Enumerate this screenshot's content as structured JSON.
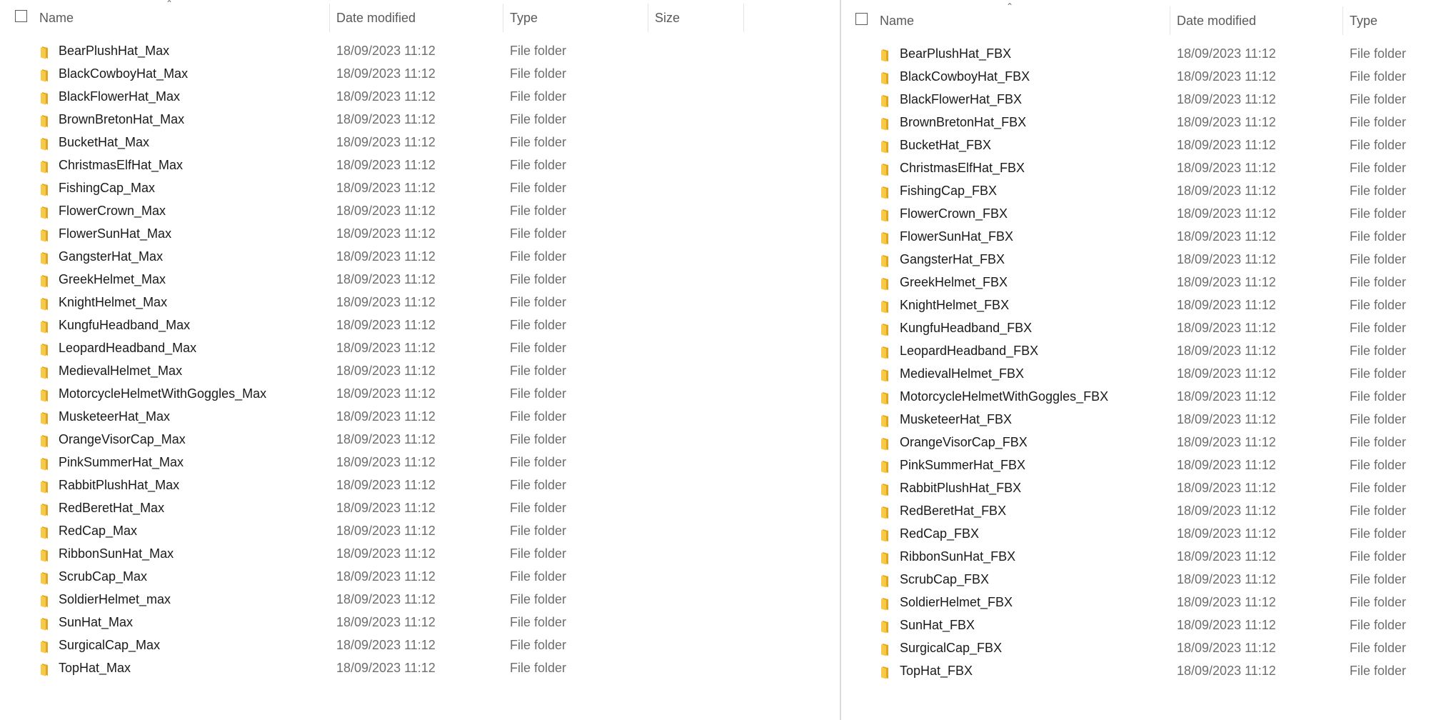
{
  "colors": {
    "folder": "#F8C84A",
    "folder_shade": "#E3A71F",
    "header_text": "#5a5a5a",
    "muted_text": "#6d6d6d"
  },
  "left_pane": {
    "columns": {
      "name": "Name",
      "date_modified": "Date modified",
      "type": "Type",
      "size": "Size"
    },
    "rows": [
      {
        "name": "BearPlushHat_Max",
        "date": "18/09/2023 11:12",
        "type": "File folder"
      },
      {
        "name": "BlackCowboyHat_Max",
        "date": "18/09/2023 11:12",
        "type": "File folder"
      },
      {
        "name": "BlackFlowerHat_Max",
        "date": "18/09/2023 11:12",
        "type": "File folder"
      },
      {
        "name": "BrownBretonHat_Max",
        "date": "18/09/2023 11:12",
        "type": "File folder"
      },
      {
        "name": "BucketHat_Max",
        "date": "18/09/2023 11:12",
        "type": "File folder"
      },
      {
        "name": "ChristmasElfHat_Max",
        "date": "18/09/2023 11:12",
        "type": "File folder"
      },
      {
        "name": "FishingCap_Max",
        "date": "18/09/2023 11:12",
        "type": "File folder"
      },
      {
        "name": "FlowerCrown_Max",
        "date": "18/09/2023 11:12",
        "type": "File folder"
      },
      {
        "name": "FlowerSunHat_Max",
        "date": "18/09/2023 11:12",
        "type": "File folder"
      },
      {
        "name": "GangsterHat_Max",
        "date": "18/09/2023 11:12",
        "type": "File folder"
      },
      {
        "name": "GreekHelmet_Max",
        "date": "18/09/2023 11:12",
        "type": "File folder"
      },
      {
        "name": "KnightHelmet_Max",
        "date": "18/09/2023 11:12",
        "type": "File folder"
      },
      {
        "name": "KungfuHeadband_Max",
        "date": "18/09/2023 11:12",
        "type": "File folder"
      },
      {
        "name": "LeopardHeadband_Max",
        "date": "18/09/2023 11:12",
        "type": "File folder"
      },
      {
        "name": "MedievalHelmet_Max",
        "date": "18/09/2023 11:12",
        "type": "File folder"
      },
      {
        "name": "MotorcycleHelmetWithGoggles_Max",
        "date": "18/09/2023 11:12",
        "type": "File folder"
      },
      {
        "name": "MusketeerHat_Max",
        "date": "18/09/2023 11:12",
        "type": "File folder"
      },
      {
        "name": "OrangeVisorCap_Max",
        "date": "18/09/2023 11:12",
        "type": "File folder"
      },
      {
        "name": "PinkSummerHat_Max",
        "date": "18/09/2023 11:12",
        "type": "File folder"
      },
      {
        "name": "RabbitPlushHat_Max",
        "date": "18/09/2023 11:12",
        "type": "File folder"
      },
      {
        "name": "RedBeretHat_Max",
        "date": "18/09/2023 11:12",
        "type": "File folder"
      },
      {
        "name": "RedCap_Max",
        "date": "18/09/2023 11:12",
        "type": "File folder"
      },
      {
        "name": "RibbonSunHat_Max",
        "date": "18/09/2023 11:12",
        "type": "File folder"
      },
      {
        "name": "ScrubCap_Max",
        "date": "18/09/2023 11:12",
        "type": "File folder"
      },
      {
        "name": "SoldierHelmet_max",
        "date": "18/09/2023 11:12",
        "type": "File folder"
      },
      {
        "name": "SunHat_Max",
        "date": "18/09/2023 11:12",
        "type": "File folder"
      },
      {
        "name": "SurgicalCap_Max",
        "date": "18/09/2023 11:12",
        "type": "File folder"
      },
      {
        "name": "TopHat_Max",
        "date": "18/09/2023 11:12",
        "type": "File folder"
      }
    ]
  },
  "right_pane": {
    "columns": {
      "name": "Name",
      "date_modified": "Date modified",
      "type": "Type"
    },
    "rows": [
      {
        "name": "BearPlushHat_FBX",
        "date": "18/09/2023 11:12",
        "type": "File folder"
      },
      {
        "name": "BlackCowboyHat_FBX",
        "date": "18/09/2023 11:12",
        "type": "File folder"
      },
      {
        "name": "BlackFlowerHat_FBX",
        "date": "18/09/2023 11:12",
        "type": "File folder"
      },
      {
        "name": "BrownBretonHat_FBX",
        "date": "18/09/2023 11:12",
        "type": "File folder"
      },
      {
        "name": "BucketHat_FBX",
        "date": "18/09/2023 11:12",
        "type": "File folder"
      },
      {
        "name": "ChristmasElfHat_FBX",
        "date": "18/09/2023 11:12",
        "type": "File folder"
      },
      {
        "name": "FishingCap_FBX",
        "date": "18/09/2023 11:12",
        "type": "File folder"
      },
      {
        "name": "FlowerCrown_FBX",
        "date": "18/09/2023 11:12",
        "type": "File folder"
      },
      {
        "name": "FlowerSunHat_FBX",
        "date": "18/09/2023 11:12",
        "type": "File folder"
      },
      {
        "name": "GangsterHat_FBX",
        "date": "18/09/2023 11:12",
        "type": "File folder"
      },
      {
        "name": "GreekHelmet_FBX",
        "date": "18/09/2023 11:12",
        "type": "File folder"
      },
      {
        "name": "KnightHelmet_FBX",
        "date": "18/09/2023 11:12",
        "type": "File folder"
      },
      {
        "name": "KungfuHeadband_FBX",
        "date": "18/09/2023 11:12",
        "type": "File folder"
      },
      {
        "name": "LeopardHeadband_FBX",
        "date": "18/09/2023 11:12",
        "type": "File folder"
      },
      {
        "name": "MedievalHelmet_FBX",
        "date": "18/09/2023 11:12",
        "type": "File folder"
      },
      {
        "name": "MotorcycleHelmetWithGoggles_FBX",
        "date": "18/09/2023 11:12",
        "type": "File folder"
      },
      {
        "name": "MusketeerHat_FBX",
        "date": "18/09/2023 11:12",
        "type": "File folder"
      },
      {
        "name": "OrangeVisorCap_FBX",
        "date": "18/09/2023 11:12",
        "type": "File folder"
      },
      {
        "name": "PinkSummerHat_FBX",
        "date": "18/09/2023 11:12",
        "type": "File folder"
      },
      {
        "name": "RabbitPlushHat_FBX",
        "date": "18/09/2023 11:12",
        "type": "File folder"
      },
      {
        "name": "RedBeretHat_FBX",
        "date": "18/09/2023 11:12",
        "type": "File folder"
      },
      {
        "name": "RedCap_FBX",
        "date": "18/09/2023 11:12",
        "type": "File folder"
      },
      {
        "name": "RibbonSunHat_FBX",
        "date": "18/09/2023 11:12",
        "type": "File folder"
      },
      {
        "name": "ScrubCap_FBX",
        "date": "18/09/2023 11:12",
        "type": "File folder"
      },
      {
        "name": "SoldierHelmet_FBX",
        "date": "18/09/2023 11:12",
        "type": "File folder"
      },
      {
        "name": "SunHat_FBX",
        "date": "18/09/2023 11:12",
        "type": "File folder"
      },
      {
        "name": "SurgicalCap_FBX",
        "date": "18/09/2023 11:12",
        "type": "File folder"
      },
      {
        "name": "TopHat_FBX",
        "date": "18/09/2023 11:12",
        "type": "File folder"
      }
    ]
  }
}
